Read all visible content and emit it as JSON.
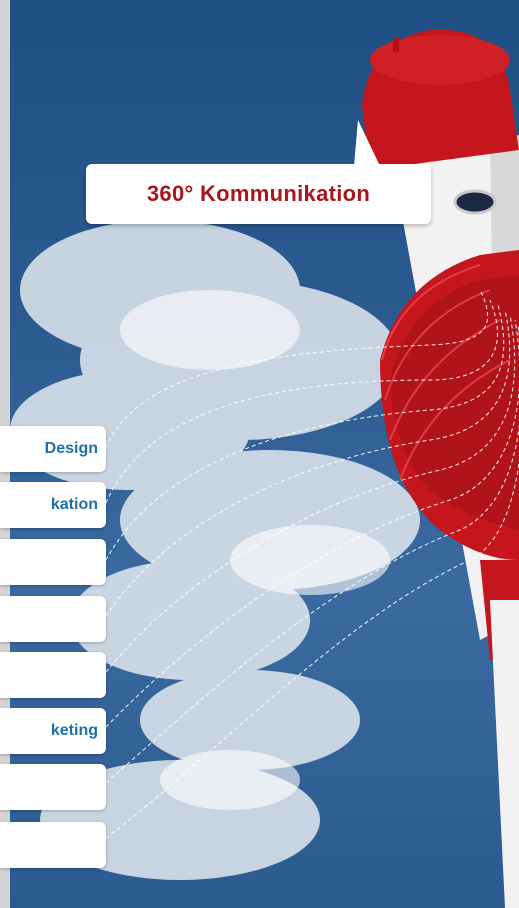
{
  "headline": {
    "label": "360° Kommunikation",
    "color": "#a8161b"
  },
  "menu": {
    "link_color": "#1e6fa8",
    "items": [
      {
        "label": "Design"
      },
      {
        "label": "kation"
      },
      {
        "label": ""
      },
      {
        "label": ""
      },
      {
        "label": ""
      },
      {
        "label": "keting"
      },
      {
        "label": ""
      },
      {
        "label": ""
      }
    ]
  },
  "colors": {
    "tower_red": "#c4161c",
    "sky_blue": "#2a5a8f",
    "tower_white": "#f2f2f2"
  }
}
